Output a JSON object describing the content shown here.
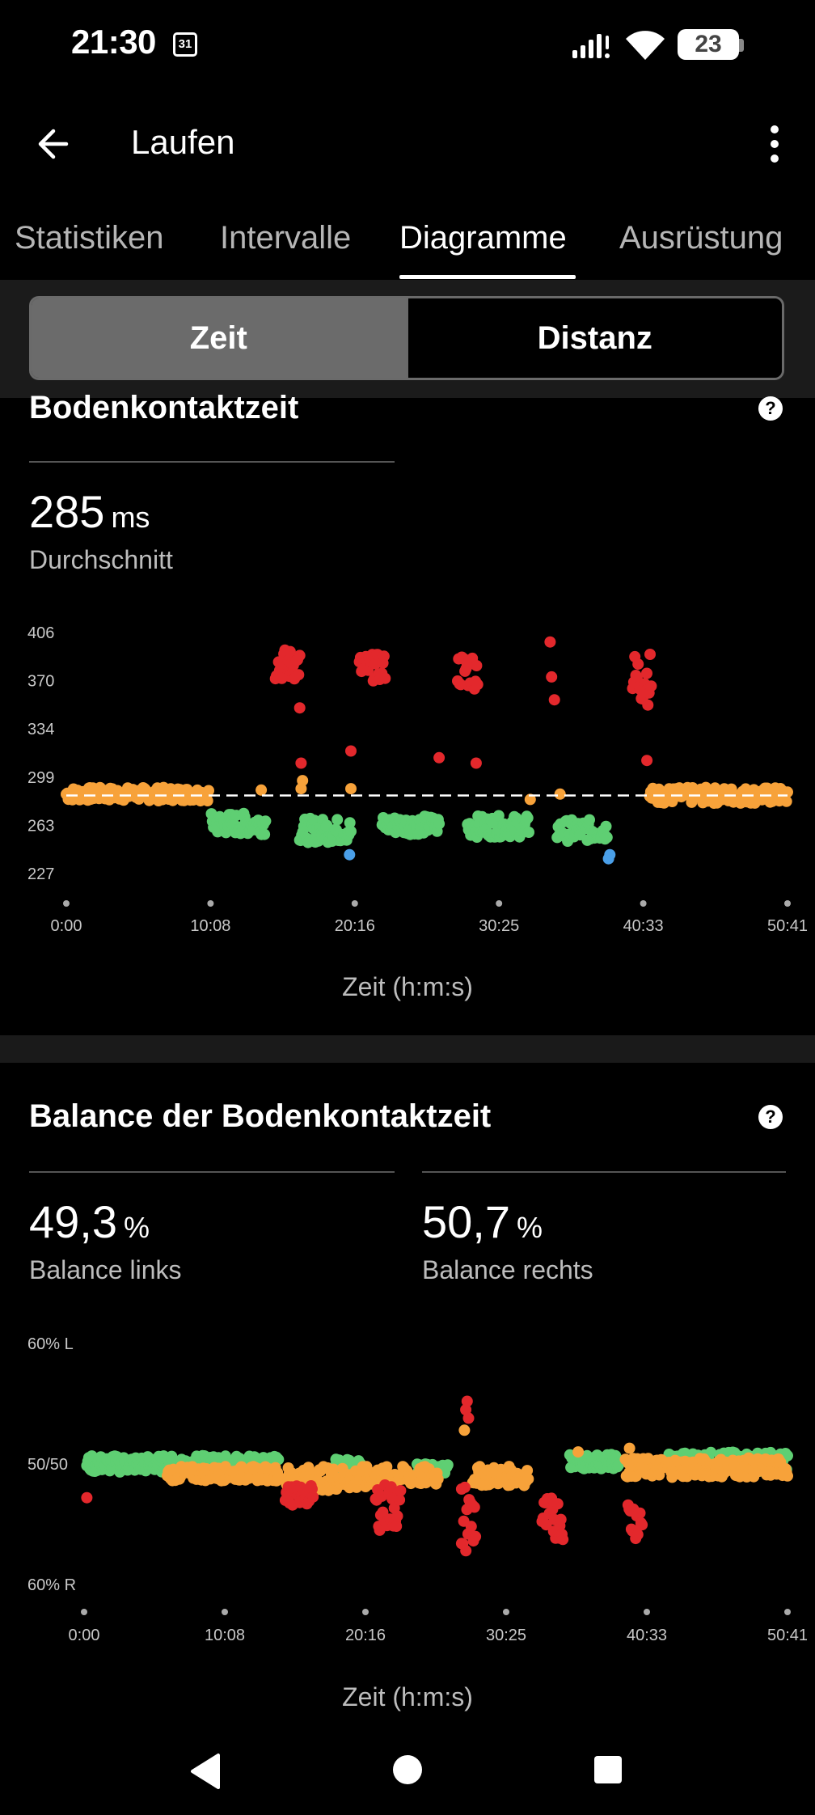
{
  "status_bar": {
    "time": "21:30",
    "calendar_day": "31",
    "battery": "23"
  },
  "app_bar": {
    "title": "Laufen"
  },
  "tabs": [
    {
      "label": "Statistiken",
      "active": false
    },
    {
      "label": "Intervalle",
      "active": false
    },
    {
      "label": "Diagramme",
      "active": true
    },
    {
      "label": "Ausrüstung",
      "active": false
    }
  ],
  "toggle": {
    "left": "Zeit",
    "right": "Distanz",
    "selected": "Zeit"
  },
  "gct": {
    "title": "Bodenkontaktzeit",
    "value": "285",
    "unit": "ms",
    "label": "Durchschnitt",
    "x_axis_title": "Zeit (h:m:s)"
  },
  "balance": {
    "title": "Balance der Bodenkontaktzeit",
    "left_value": "49,3",
    "left_unit": "%",
    "left_label": "Balance links",
    "right_value": "50,7",
    "right_unit": "%",
    "right_label": "Balance rechts",
    "x_axis_title": "Zeit (h:m:s)"
  },
  "colors": {
    "red": "#e3282c",
    "orange": "#f7a23a",
    "green": "#5fcf73",
    "blue": "#4a9fe8",
    "bg": "#000000"
  },
  "chart_data": [
    {
      "type": "scatter",
      "title": "Bodenkontaktzeit",
      "xlabel": "Zeit (h:m:s)",
      "ylabel": "",
      "x_tick_labels": [
        "0:00",
        "10:08",
        "20:16",
        "30:25",
        "40:33",
        "50:41"
      ],
      "y_tick_labels": [
        "406",
        "370",
        "334",
        "299",
        "263",
        "227"
      ],
      "xlim": [
        0,
        50.68
      ],
      "ylim": [
        227,
        406
      ],
      "average_line": 285,
      "grid": false,
      "x_unit": "minutes",
      "series": [
        {
          "color": "orange",
          "segments": [
            {
              "x0": 0.0,
              "x1": 10.0,
              "y": 286,
              "spread": 5
            },
            {
              "x0": 41.0,
              "x1": 50.68,
              "y": 285,
              "spread": 6
            }
          ],
          "points": [
            [
              13.7,
              289
            ],
            [
              16.6,
              296
            ],
            [
              16.5,
              290
            ],
            [
              20.0,
              290
            ],
            [
              32.6,
              282
            ],
            [
              34.7,
              286
            ]
          ]
        },
        {
          "color": "green",
          "segments": [
            {
              "x0": 10.2,
              "x1": 14.0,
              "y": 264,
              "spread": 8
            },
            {
              "x0": 16.4,
              "x1": 20.0,
              "y": 259,
              "spread": 9
            },
            {
              "x0": 22.2,
              "x1": 26.2,
              "y": 263,
              "spread": 7
            },
            {
              "x0": 28.2,
              "x1": 32.5,
              "y": 262,
              "spread": 8
            },
            {
              "x0": 34.5,
              "x1": 38.0,
              "y": 259,
              "spread": 8
            }
          ]
        },
        {
          "color": "red",
          "segments": [
            {
              "x0": 14.7,
              "x1": 16.4,
              "y": 382,
              "spread": 12
            },
            {
              "x0": 20.6,
              "x1": 22.4,
              "y": 380,
              "spread": 10
            },
            {
              "x0": 27.5,
              "x1": 28.9,
              "y": 378,
              "spread": 14
            },
            {
              "x0": 39.8,
              "x1": 41.1,
              "y": 372,
              "spread": 20
            }
          ],
          "points": [
            [
              16.4,
              350
            ],
            [
              16.5,
              309
            ],
            [
              20.0,
              318
            ],
            [
              26.2,
              313
            ],
            [
              28.8,
              309
            ],
            [
              34.0,
              399
            ],
            [
              34.1,
              373
            ],
            [
              34.3,
              356
            ],
            [
              40.8,
              311
            ]
          ]
        },
        {
          "color": "blue",
          "points": [
            [
              19.9,
              241
            ],
            [
              38.1,
              238
            ],
            [
              38.2,
              241
            ]
          ]
        }
      ]
    },
    {
      "type": "scatter",
      "title": "Balance der Bodenkontaktzeit",
      "xlabel": "Zeit (h:m:s)",
      "ylabel": "",
      "x_tick_labels": [
        "0:00",
        "10:08",
        "20:16",
        "30:25",
        "40:33",
        "50:41"
      ],
      "y_tick_labels": [
        "60% L",
        "50/50",
        "60% R"
      ],
      "xlim": [
        0,
        50.68
      ],
      "ylim": [
        -10,
        10
      ],
      "grid": false,
      "x_unit": "minutes",
      "y_meaning": "positive = left, negative = right, percent offset from 50/50",
      "series": [
        {
          "color": "green",
          "segments": [
            {
              "x0": 0.2,
              "x1": 14.0,
              "y": 0.0,
              "spread": 0.7
            },
            {
              "x0": 18.0,
              "x1": 20.0,
              "y": -0.2,
              "spread": 0.6
            },
            {
              "x0": 24.0,
              "x1": 26.2,
              "y": -0.5,
              "spread": 0.5
            },
            {
              "x0": 35.0,
              "x1": 38.5,
              "y": 0.2,
              "spread": 0.6
            },
            {
              "x0": 42.0,
              "x1": 50.68,
              "y": 0.2,
              "spread": 0.8
            }
          ]
        },
        {
          "color": "orange",
          "segments": [
            {
              "x0": 6.0,
              "x1": 14.0,
              "y": -0.8,
              "spread": 0.6
            },
            {
              "x0": 14.5,
              "x1": 20.5,
              "y": -1.2,
              "spread": 1.0
            },
            {
              "x0": 20.5,
              "x1": 25.5,
              "y": -1.0,
              "spread": 0.8
            },
            {
              "x0": 28.0,
              "x1": 32.0,
              "y": -1.0,
              "spread": 0.8
            },
            {
              "x0": 39.0,
              "x1": 50.68,
              "y": -0.3,
              "spread": 0.8
            }
          ],
          "points": [
            [
              27.4,
              2.8
            ],
            [
              35.6,
              1.0
            ],
            [
              39.3,
              1.3
            ]
          ]
        },
        {
          "color": "red",
          "segments": [
            {
              "x0": 14.5,
              "x1": 16.5,
              "y": -2.6,
              "spread": 0.8
            },
            {
              "x0": 21.0,
              "x1": 22.8,
              "y": -3.5,
              "spread": 2.0
            },
            {
              "x0": 27.2,
              "x1": 28.2,
              "y": -4.5,
              "spread": 3.0
            },
            {
              "x0": 33.0,
              "x1": 34.5,
              "y": -4.5,
              "spread": 1.8
            },
            {
              "x0": 39.2,
              "x1": 40.2,
              "y": -4.5,
              "spread": 1.8
            }
          ],
          "points": [
            [
              0.2,
              -2.8
            ],
            [
              27.5,
              4.5
            ],
            [
              27.6,
              5.2
            ],
            [
              27.7,
              3.8
            ],
            [
              27.2,
              -6.6
            ]
          ]
        }
      ]
    }
  ]
}
